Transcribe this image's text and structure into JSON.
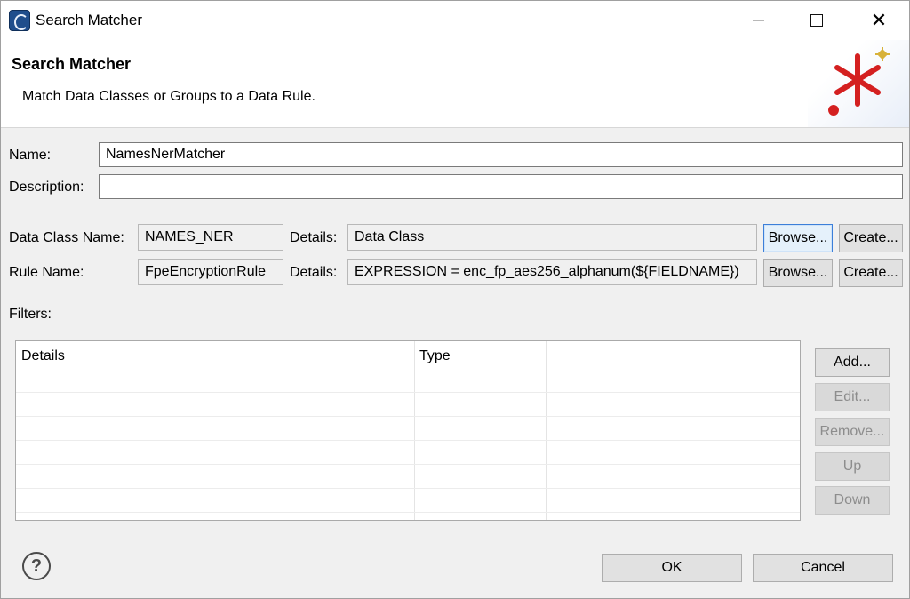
{
  "window": {
    "title": "Search Matcher"
  },
  "banner": {
    "title": "Search Matcher",
    "description": "Match Data Classes or Groups to a Data Rule."
  },
  "form": {
    "name_label": "Name:",
    "name_value": "NamesNerMatcher",
    "description_label": "Description:",
    "description_value": "",
    "data_class_label": "Data Class Name:",
    "data_class_value": "NAMES_NER",
    "details_label": "Details:",
    "data_class_details": "Data Class",
    "rule_label": "Rule Name:",
    "rule_value": "FpeEncryptionRule",
    "rule_details": "EXPRESSION = enc_fp_aes256_alphanum(${FIELDNAME})",
    "browse_label": "Browse...",
    "create_label": "Create...",
    "filters_label": "Filters:"
  },
  "filters_table": {
    "columns": [
      "Details",
      "Type",
      ""
    ],
    "rows": []
  },
  "side_buttons": {
    "add": "Add...",
    "edit": "Edit...",
    "remove": "Remove...",
    "up": "Up",
    "down": "Down"
  },
  "footer": {
    "help_glyph": "?",
    "ok": "OK",
    "cancel": "Cancel"
  },
  "icons": {
    "app": "search-matcher-app-icon",
    "banner": "red-asterisk-wizard-icon",
    "help": "help-icon"
  },
  "colors": {
    "focus_border": "#3c7fd9",
    "asterisk_red": "#d42020",
    "sparkle_gold": "#d8b23a"
  }
}
